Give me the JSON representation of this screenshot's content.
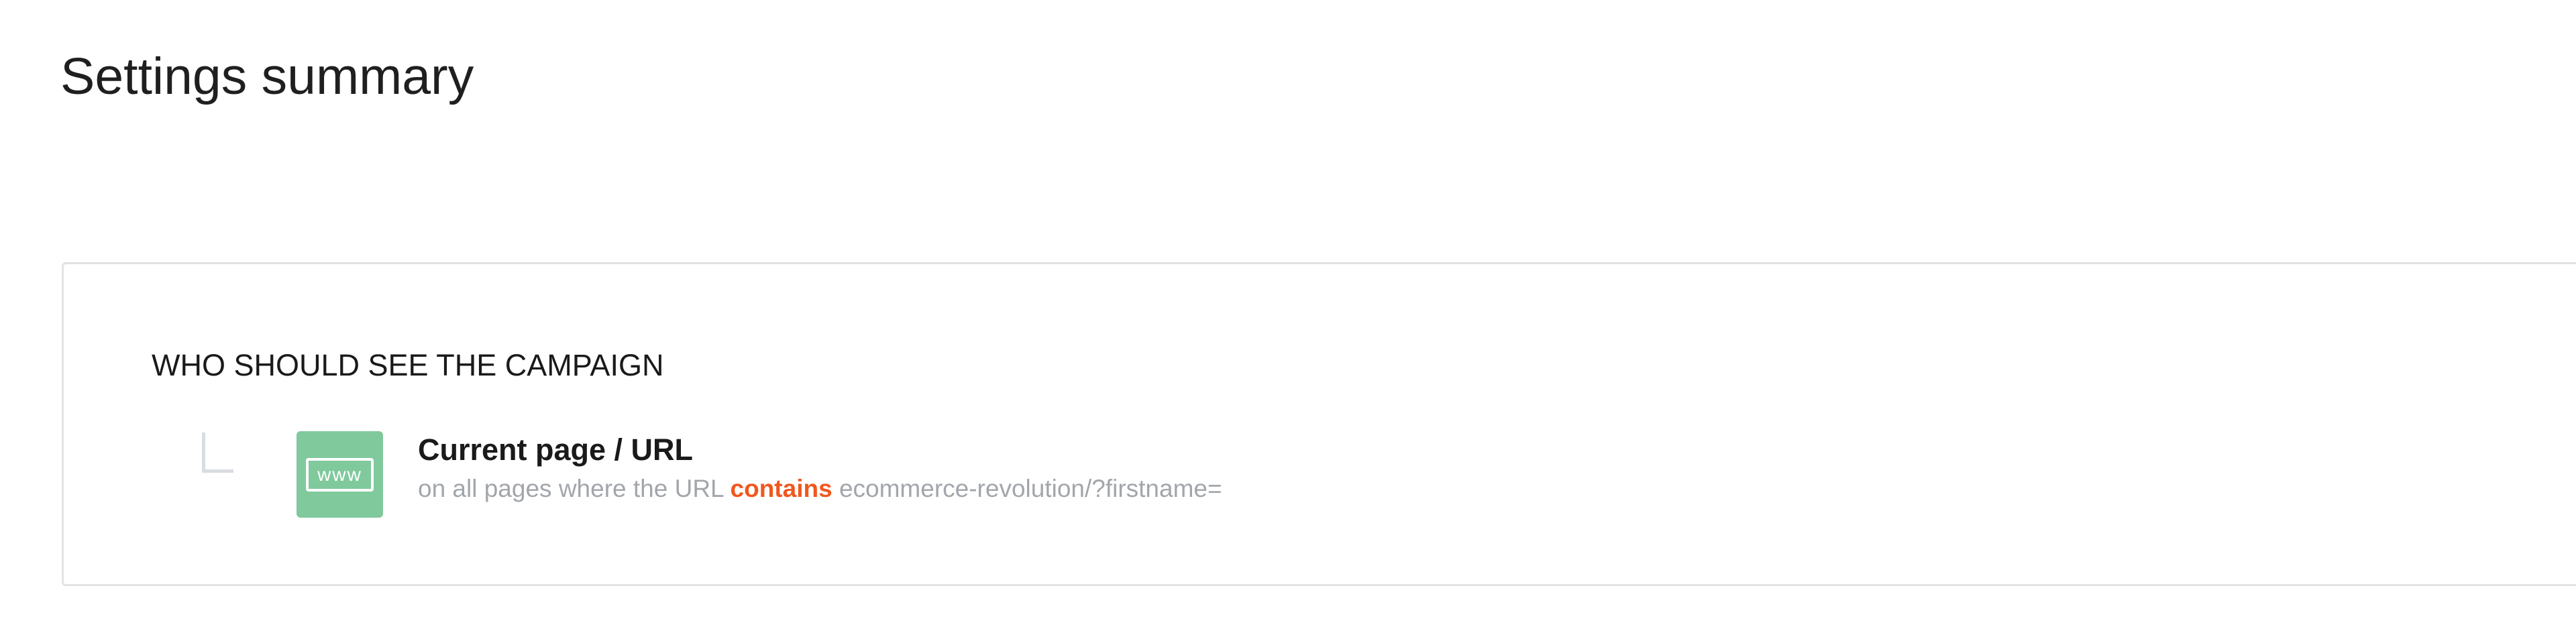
{
  "page": {
    "title": "Settings summary"
  },
  "audience_section": {
    "heading": "WHO SHOULD SEE THE CAMPAIGN",
    "conditions": [
      {
        "icon": "www-icon",
        "icon_text": "www",
        "icon_color": "#80c99d",
        "title": "Current page / URL",
        "detail_prefix": "on all pages where the URL",
        "operator": "contains",
        "operator_color": "#f0571e",
        "value": "ecommerce-revolution/?firstname="
      }
    ]
  }
}
